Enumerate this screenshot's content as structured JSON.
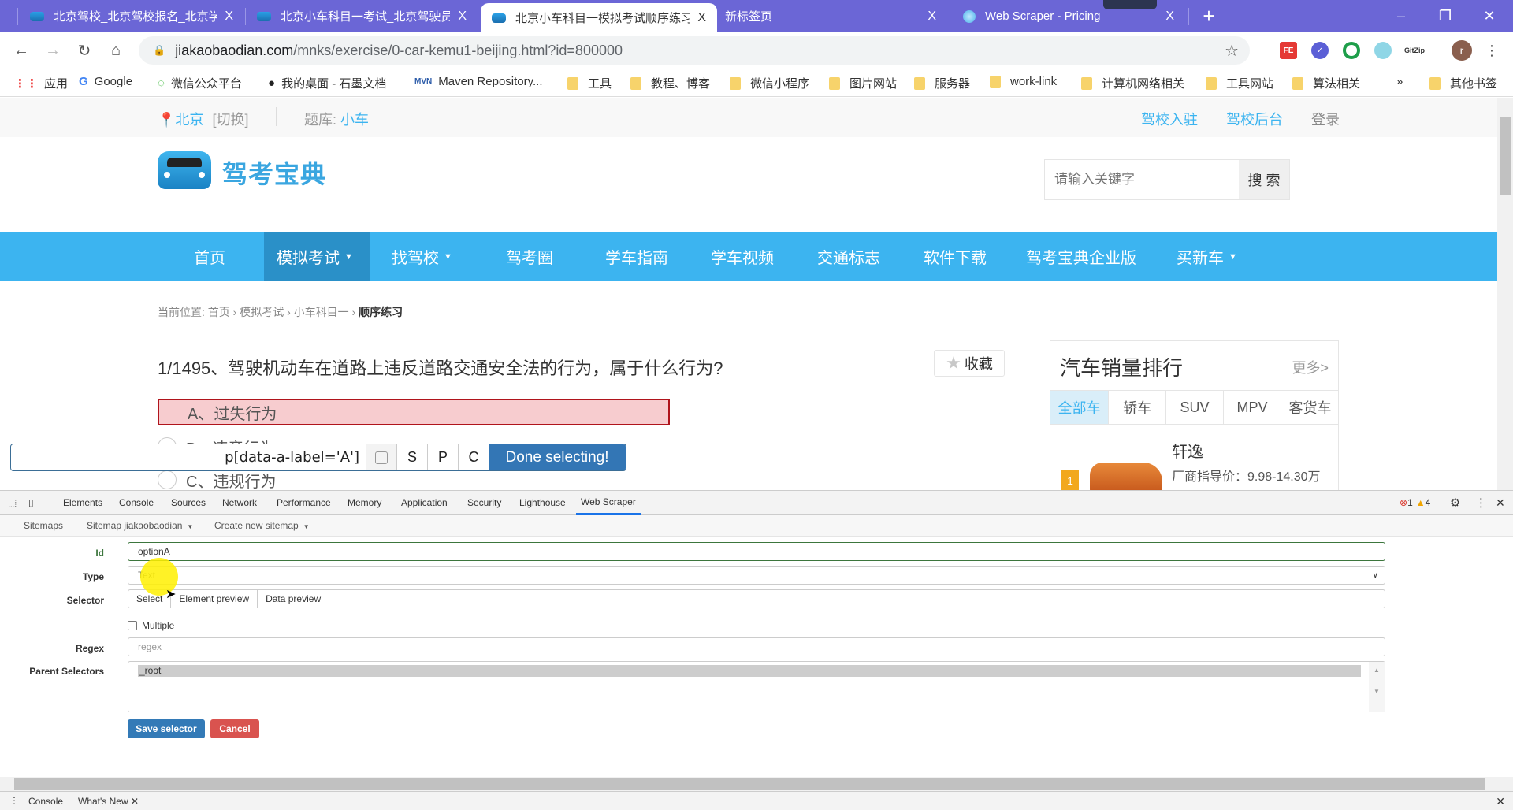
{
  "browser": {
    "tabs": [
      {
        "title": "北京驾校_北京驾校报名_北京学车",
        "active": false,
        "icon": "car-favicon"
      },
      {
        "title": "北京小车科目一考试_北京驾驶员",
        "active": false,
        "icon": "car-favicon"
      },
      {
        "title": "北京小车科目一模拟考试顺序练习",
        "active": true,
        "icon": "car-favicon"
      },
      {
        "title": "新标签页",
        "active": false,
        "icon": "none"
      },
      {
        "title": "Web Scraper - Pricing",
        "active": false,
        "icon": "web-scraper-favicon"
      }
    ],
    "new_tab_label": "+",
    "close_tab_glyph": "X",
    "window_controls": {
      "minimize": "–",
      "restore": "❐",
      "close": "✕"
    },
    "address": {
      "host": "jiakaobaodian.com",
      "path": "/mnks/exercise/0-car-kemu1-beijing.html?id=800000"
    },
    "extensions": [
      "FE",
      "check-extension",
      "green-ring-extension",
      "web-scraper-extension",
      "GitZip"
    ],
    "profile_initial": "r",
    "bookmarks": [
      {
        "label": "应用",
        "icon": "apps-grid-icon"
      },
      {
        "label": "Google",
        "icon": "google-icon"
      },
      {
        "label": "微信公众平台",
        "icon": "wechat-icon"
      },
      {
        "label": "我的桌面 - 石墨文档",
        "icon": "shimo-icon"
      },
      {
        "label": "Maven Repository...",
        "icon": "maven-icon"
      },
      {
        "label": "工具",
        "icon": "folder-icon"
      },
      {
        "label": "教程、博客",
        "icon": "folder-icon"
      },
      {
        "label": "微信小程序",
        "icon": "folder-icon"
      },
      {
        "label": "图片网站",
        "icon": "folder-icon"
      },
      {
        "label": "服务器",
        "icon": "folder-icon"
      },
      {
        "label": "work-link",
        "icon": "folder-icon"
      },
      {
        "label": "计算机网络相关",
        "icon": "folder-icon"
      },
      {
        "label": "工具网站",
        "icon": "folder-icon"
      },
      {
        "label": "算法相关",
        "icon": "folder-icon"
      }
    ],
    "bookmarks_overflow": "»",
    "other_bookmarks": "其他书签"
  },
  "site": {
    "topbar": {
      "city": "北京",
      "switch": "[切换]",
      "bank_label": "题库:",
      "bank_value": "小车",
      "links": [
        "驾校入驻",
        "驾校后台",
        "登录"
      ]
    },
    "logo_text": "驾考宝典",
    "search": {
      "placeholder": "请输入关键字",
      "button": "搜 索"
    },
    "nav": [
      {
        "label": "首页",
        "dropdown": false,
        "active": false
      },
      {
        "label": "模拟考试",
        "dropdown": true,
        "active": true
      },
      {
        "label": "找驾校",
        "dropdown": true,
        "active": false
      },
      {
        "label": "驾考圈",
        "dropdown": false,
        "active": false
      },
      {
        "label": "学车指南",
        "dropdown": false,
        "active": false
      },
      {
        "label": "学车视频",
        "dropdown": false,
        "active": false
      },
      {
        "label": "交通标志",
        "dropdown": false,
        "active": false
      },
      {
        "label": "软件下载",
        "dropdown": false,
        "active": false
      },
      {
        "label": "驾考宝典企业版",
        "dropdown": false,
        "active": false
      },
      {
        "label": "买新车",
        "dropdown": true,
        "active": false
      }
    ],
    "breadcrumb": {
      "prefix": "当前位置:",
      "items": [
        "首页",
        "模拟考试",
        "小车科目一"
      ],
      "current": "顺序练习"
    },
    "question": {
      "text": "1/1495、驾驶机动车在道路上违反道路交通安全法的行为，属于什么行为?",
      "favorite": "收藏",
      "options": [
        {
          "label": "A、过失行为",
          "highlighted": true
        },
        {
          "label": "B、违章行为",
          "highlighted": false
        },
        {
          "label": "C、违规行为",
          "highlighted": false
        }
      ]
    },
    "sales": {
      "title": "汽车销量排行",
      "more": "更多>",
      "tabs": [
        "全部车",
        "轿车",
        "SUV",
        "MPV",
        "客货车"
      ],
      "active_tab": "全部车",
      "items": [
        {
          "rank": "1",
          "name": "轩逸",
          "price": "厂商指导价：9.98-14.30万"
        }
      ]
    }
  },
  "selector_toolbar": {
    "selector": "p[data-a-label='A']",
    "buttons": [
      "S",
      "P",
      "C"
    ],
    "done": "Done selecting!"
  },
  "devtools": {
    "tabs": [
      "Elements",
      "Console",
      "Sources",
      "Network",
      "Performance",
      "Memory",
      "Application",
      "Security",
      "Lighthouse",
      "Web Scraper"
    ],
    "active_tab": "Web Scraper",
    "errors": "1",
    "warnings": "4",
    "ws_nav": [
      "Sitemaps",
      "Sitemap jiakaobaodian",
      "Create new sitemap"
    ],
    "form": {
      "id_label": "Id",
      "id_value": "optionA",
      "type_label": "Type",
      "type_value": "Text",
      "selector_label": "Selector",
      "selector_buttons": [
        "Select",
        "Element preview",
        "Data preview"
      ],
      "selector_value": "",
      "multiple_label": "Multiple",
      "multiple_checked": false,
      "regex_label": "Regex",
      "regex_placeholder": "regex",
      "parent_label": "Parent Selectors",
      "parent_options": [
        "_root"
      ],
      "save": "Save selector",
      "cancel": "Cancel"
    },
    "drawer_tabs": [
      "Console",
      "What's New"
    ]
  }
}
